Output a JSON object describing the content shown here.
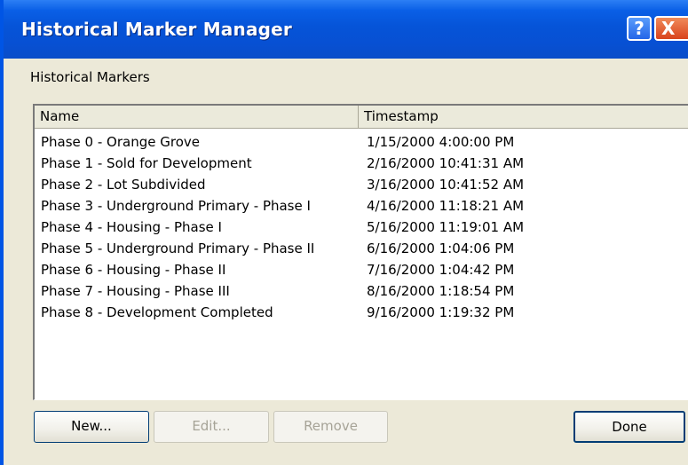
{
  "window": {
    "title": "Historical Marker Manager",
    "help_glyph": "?",
    "close_glyph": "X"
  },
  "section_label": "Historical Markers",
  "list": {
    "columns": [
      "Name",
      "Timestamp"
    ],
    "rows": [
      {
        "name": "Phase 0 - Orange Grove",
        "timestamp": "1/15/2000 4:00:00 PM"
      },
      {
        "name": "Phase 1 - Sold for Development",
        "timestamp": "2/16/2000 10:41:31 AM"
      },
      {
        "name": "Phase 2 - Lot Subdivided",
        "timestamp": "3/16/2000 10:41:52 AM"
      },
      {
        "name": "Phase 3 - Underground Primary - Phase I",
        "timestamp": "4/16/2000 11:18:21 AM"
      },
      {
        "name": "Phase 4 - Housing - Phase I",
        "timestamp": "5/16/2000 11:19:01 AM"
      },
      {
        "name": "Phase 5 - Underground Primary - Phase II",
        "timestamp": "6/16/2000 1:04:06 PM"
      },
      {
        "name": "Phase 6 - Housing - Phase II",
        "timestamp": "7/16/2000 1:04:42 PM"
      },
      {
        "name": "Phase 7 - Housing - Phase III",
        "timestamp": "8/16/2000 1:18:54 PM"
      },
      {
        "name": "Phase 8 - Development Completed",
        "timestamp": "9/16/2000 1:19:32 PM"
      }
    ]
  },
  "buttons": {
    "new_label": "New...",
    "edit_label": "Edit...",
    "remove_label": "Remove",
    "done_label": "Done"
  },
  "colors": {
    "titlebar": "#0654d8",
    "window_bg": "#ece9d8",
    "close_button": "#d9431c"
  },
  "icons": {
    "help": "help-icon",
    "close": "close-icon"
  }
}
